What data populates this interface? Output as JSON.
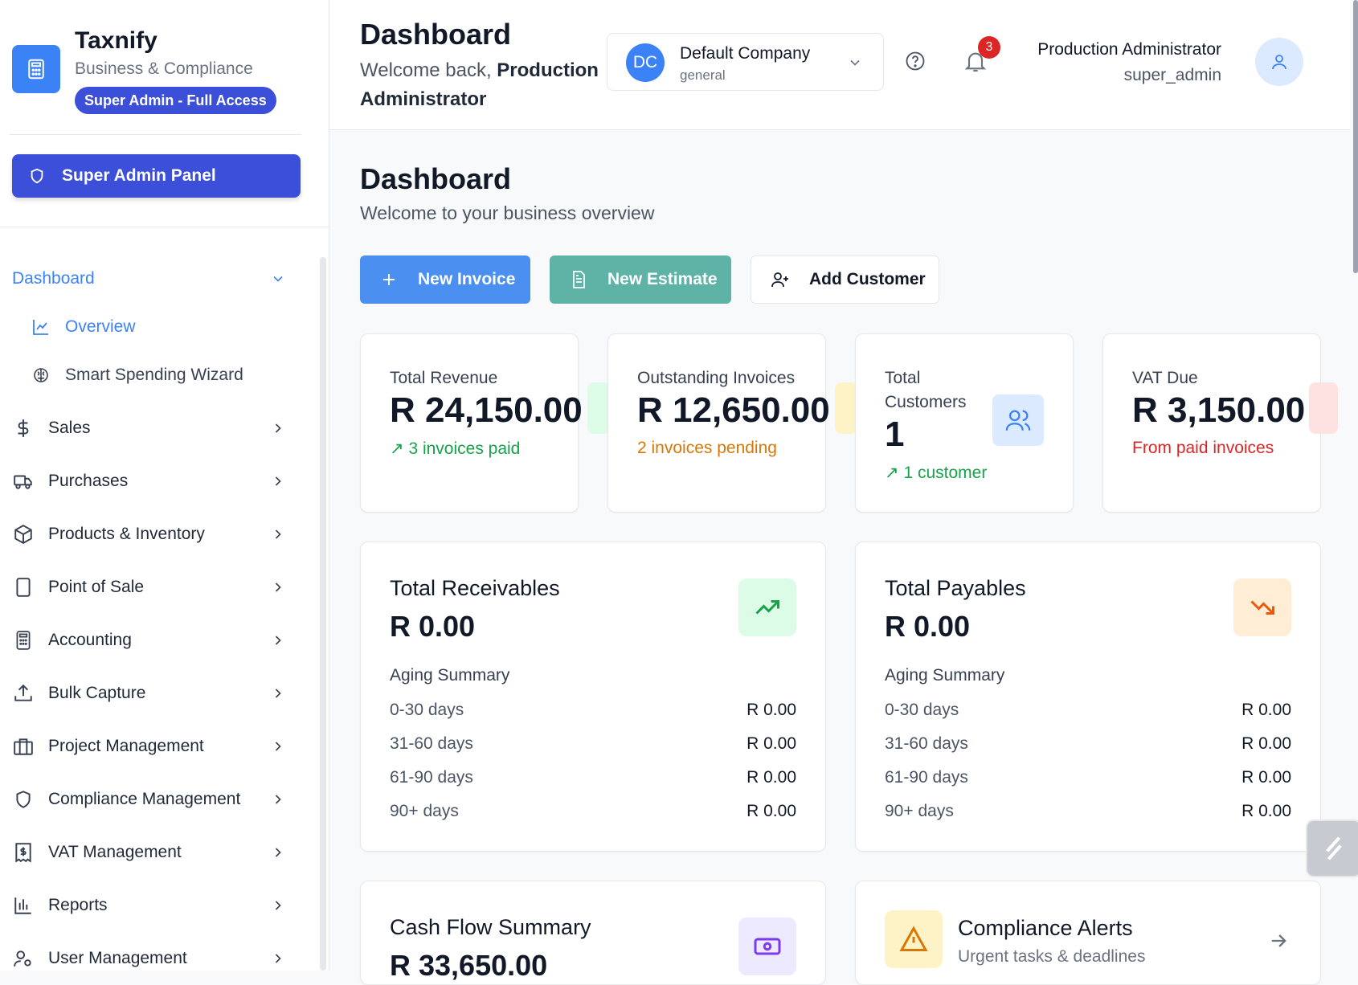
{
  "sidebar": {
    "brand_name": "Taxnify",
    "brand_sub": "Business & Compliance",
    "badge": "Super Admin - Full Access",
    "admin_panel": "Super Admin Panel",
    "nav": {
      "dashboard": "Dashboard",
      "overview": "Overview",
      "smart_spending": "Smart Spending Wizard",
      "sales": "Sales",
      "purchases": "Purchases",
      "products": "Products & Inventory",
      "pos": "Point of Sale",
      "accounting": "Accounting",
      "bulk_capture": "Bulk Capture",
      "project": "Project Management",
      "compliance": "Compliance Management",
      "vat": "VAT Management",
      "reports": "Reports",
      "users": "User Management"
    }
  },
  "header": {
    "title": "Dashboard",
    "welcome_prefix": "Welcome back,",
    "welcome_name": "Production Administrator",
    "company_initials": "DC",
    "company_name": "Default Company",
    "company_type": "general",
    "notifications": "3",
    "user_name": "Production Administrator",
    "user_role": "super_admin"
  },
  "main": {
    "title": "Dashboard",
    "subtitle": "Welcome to your business overview",
    "actions": {
      "new_invoice": "New Invoice",
      "new_estimate": "New Estimate",
      "add_customer": "Add Customer"
    },
    "stats": [
      {
        "label": "Total Revenue",
        "value": "R 24,150.00",
        "note": "3 invoices paid",
        "note_color": "#16a34a"
      },
      {
        "label": "Outstanding Invoices",
        "value": "R 12,650.00",
        "note": "2 invoices pending",
        "note_color": "#d97706"
      },
      {
        "label": "Total Customers",
        "value": "1",
        "note": "1 customer",
        "note_color": "#16a34a"
      },
      {
        "label": "VAT Due",
        "value": "R 3,150.00",
        "note": "From paid invoices",
        "note_color": "#dc2626"
      }
    ],
    "receivables": {
      "title": "Total Receivables",
      "value": "R 0.00",
      "aging_title": "Aging Summary",
      "rows": [
        {
          "k": "0-30 days",
          "v": "R 0.00"
        },
        {
          "k": "31-60 days",
          "v": "R 0.00"
        },
        {
          "k": "61-90 days",
          "v": "R 0.00"
        },
        {
          "k": "90+ days",
          "v": "R 0.00"
        }
      ]
    },
    "payables": {
      "title": "Total Payables",
      "value": "R 0.00",
      "aging_title": "Aging Summary",
      "rows": [
        {
          "k": "0-30 days",
          "v": "R 0.00"
        },
        {
          "k": "31-60 days",
          "v": "R 0.00"
        },
        {
          "k": "61-90 days",
          "v": "R 0.00"
        },
        {
          "k": "90+ days",
          "v": "R 0.00"
        }
      ]
    },
    "cashflow": {
      "title": "Cash Flow Summary",
      "value": "R 33,650.00"
    },
    "compliance": {
      "title": "Compliance Alerts",
      "subtitle": "Urgent tasks & deadlines"
    }
  },
  "colors": {
    "primary": "#3b82f6",
    "admin": "#3b4fd8",
    "teal": "#5eb3a6"
  }
}
